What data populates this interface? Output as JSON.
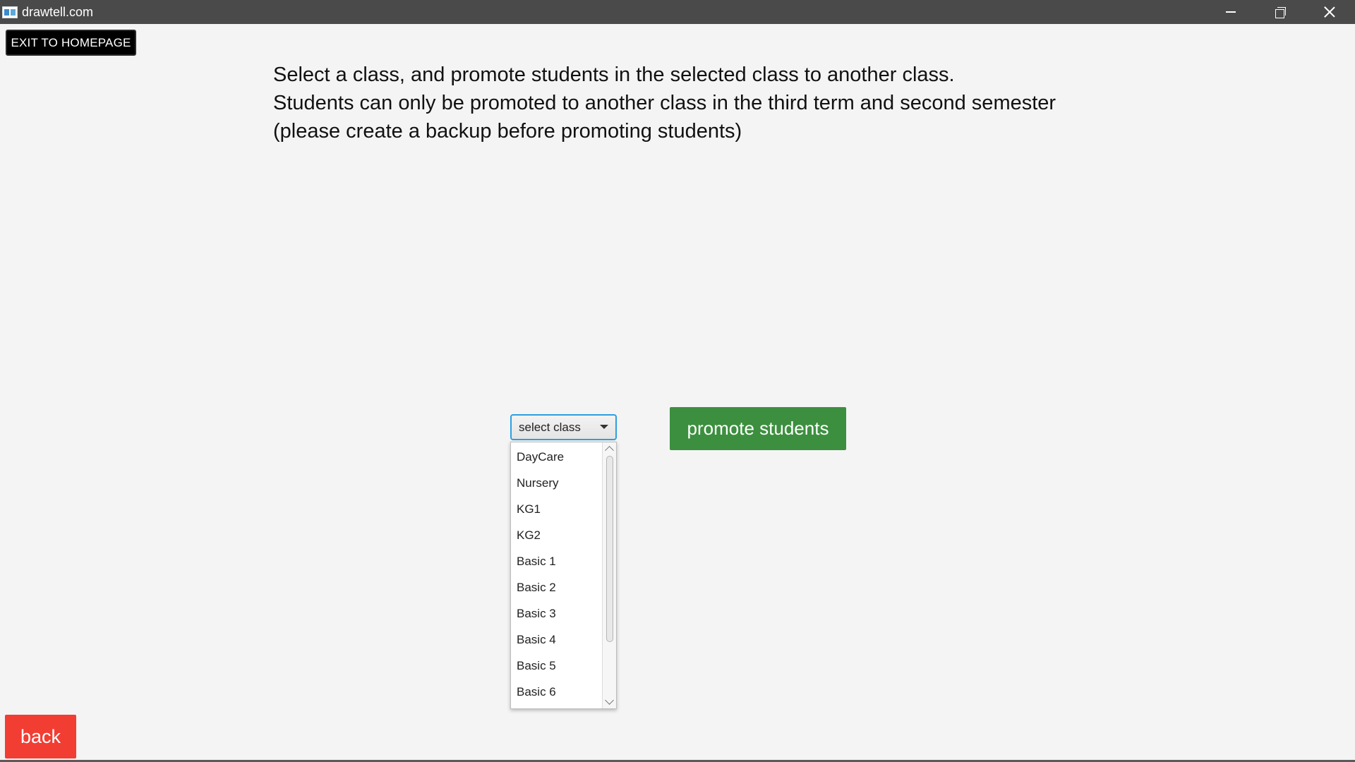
{
  "window": {
    "title": "drawtell.com",
    "controls": [
      "minimize-icon",
      "restore-icon",
      "close-icon"
    ]
  },
  "toolbar": {
    "exit_label": "EXIT TO HOMEPAGE"
  },
  "instructions": {
    "line1": "Select a class, and promote students in the selected class to another class.",
    "line2": "Students can only be promoted to another class in the third term and second semester",
    "line3": "(please create a backup before promoting students)"
  },
  "class_select": {
    "placeholder": "select class",
    "options": [
      "DayCare",
      "Nursery",
      "KG1",
      "KG2",
      "Basic 1",
      "Basic 2",
      "Basic 3",
      "Basic 4",
      "Basic 5",
      "Basic 6"
    ]
  },
  "actions": {
    "promote_label": "promote students",
    "back_label": "back"
  },
  "colors": {
    "title_bar": "#4a4a4a",
    "background": "#f4f4f4",
    "exit_button": "#000000",
    "promote_button": "#3c8f3f",
    "back_button": "#f23d33",
    "select_focus": "#2e9fe0"
  }
}
